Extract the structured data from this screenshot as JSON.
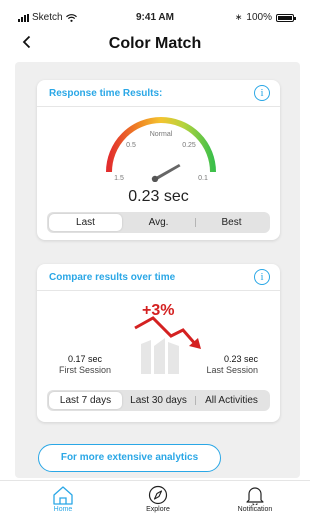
{
  "status_bar": {
    "carrier": "Sketch",
    "time": "9:41 AM",
    "battery": "100%",
    "battery_level": 1.0
  },
  "nav": {
    "title": "Color Match",
    "back_icon": "chevron-left-icon"
  },
  "response_card": {
    "title": "Response time Results:",
    "gauge": {
      "value_label": "0.23 sec",
      "value": 0.23,
      "center_label": "Normal",
      "tick_labels": [
        "1.5",
        "0.5",
        "0.25",
        "0.1"
      ],
      "colors": [
        "#e22d2d",
        "#f08a24",
        "#f4c430",
        "#b5d33d",
        "#3cbf4a"
      ]
    },
    "tabs": [
      "Last",
      "Avg.",
      "Best"
    ],
    "active_tab": 0
  },
  "compare_card": {
    "title": "Compare results over time",
    "change": "+3%",
    "first": {
      "value": "0.17 sec",
      "label": "First Session"
    },
    "last": {
      "value": "0.23 sec",
      "label": "Last Session"
    },
    "tabs": [
      "Last 7 days",
      "Last 30 days",
      "All Activities"
    ],
    "active_tab": 0,
    "trend_color": "#d42121"
  },
  "analytics_button": "For more extensive analytics",
  "tab_bar": {
    "items": [
      {
        "label": "Home",
        "icon": "home-icon",
        "active": true
      },
      {
        "label": "Explore",
        "icon": "compass-icon",
        "active": false
      },
      {
        "label": "Notification",
        "icon": "bell-icon",
        "active": false
      }
    ]
  },
  "colors": {
    "accent": "#2aa7e6",
    "trend_down": "#d42121"
  }
}
